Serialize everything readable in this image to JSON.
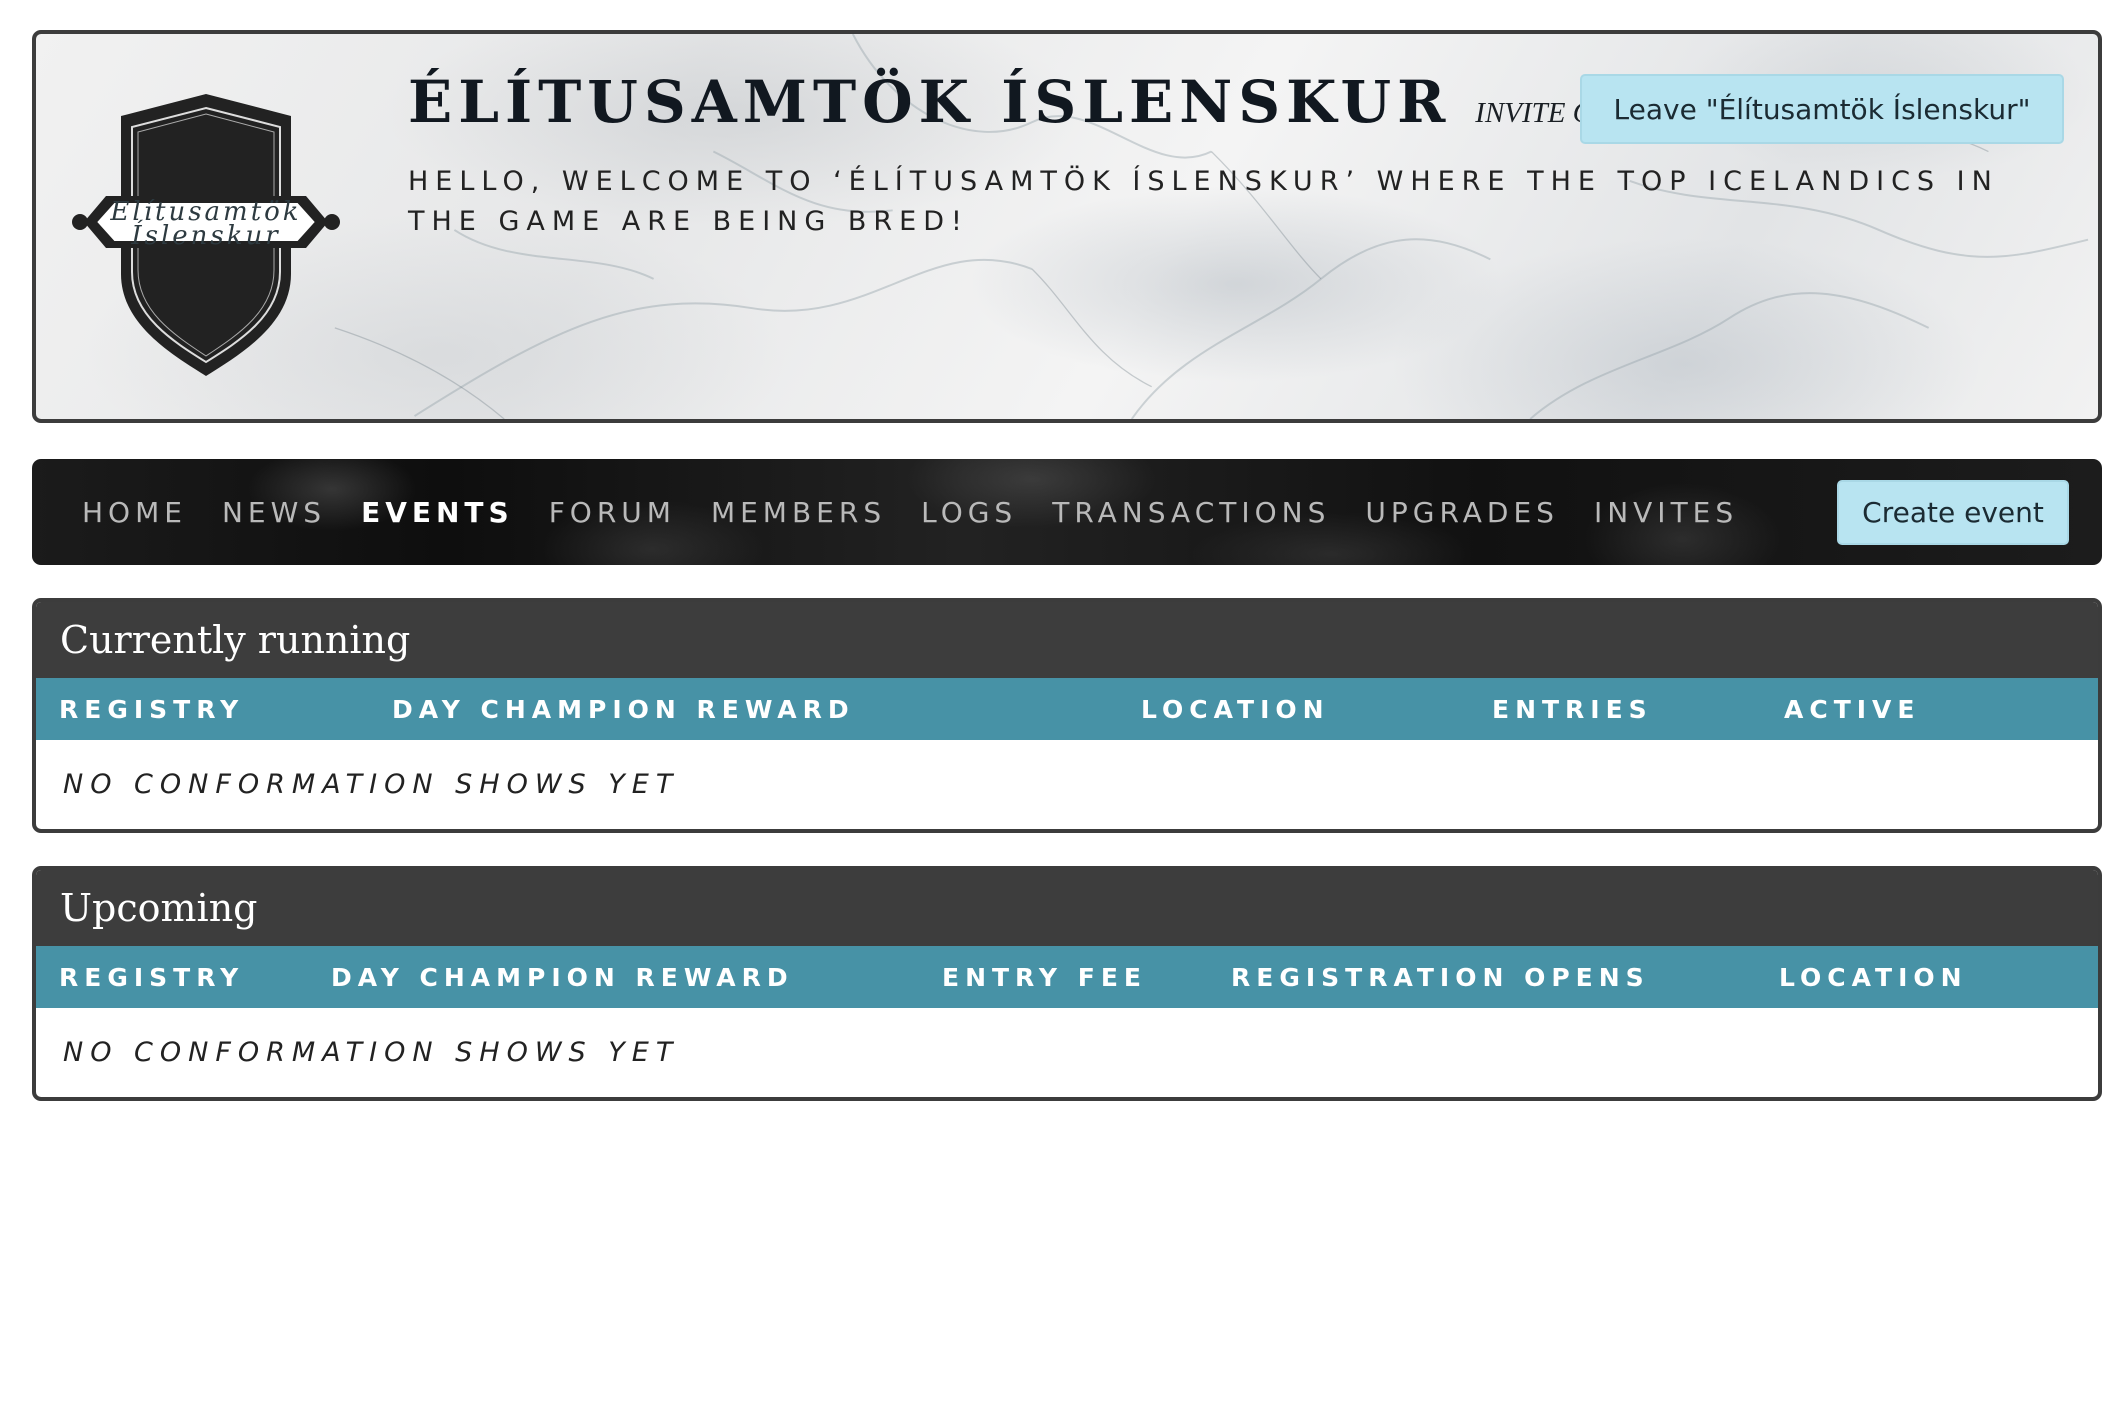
{
  "header": {
    "crest_line1": "Elítusamtök",
    "crest_line2": "Íslenskur",
    "title": "ÉLÍTUSAMTÖK ÍSLENSKUR",
    "invite_tag": "INVITE ONLY",
    "welcome": "Hello, welcome to ‘Élítusamtök Íslenskur’ where the top Icelandics in the game are being bred!",
    "leave_button": "Leave \"Élítusamtök Íslenskur\""
  },
  "nav": {
    "items": [
      "Home",
      "News",
      "Events",
      "Forum",
      "Members",
      "Logs",
      "Transactions",
      "Upgrades",
      "Invites"
    ],
    "active": "Events",
    "create_button": "Create event"
  },
  "currently_running": {
    "title": "Currently running",
    "columns": [
      "Registry",
      "Day champion reward",
      "Location",
      "Entries",
      "Active"
    ],
    "empty_text": "No conformation shows yet"
  },
  "upcoming": {
    "title": "Upcoming",
    "columns": [
      "Registry",
      "Day champion reward",
      "Entry fee",
      "Registration opens",
      "Location"
    ],
    "empty_text": "No conformation shows yet"
  },
  "colors": {
    "accent_button": "#b8e4f1",
    "table_header": "#4792a6",
    "panel_header": "#3d3d3d",
    "border": "#3c3c3c"
  }
}
